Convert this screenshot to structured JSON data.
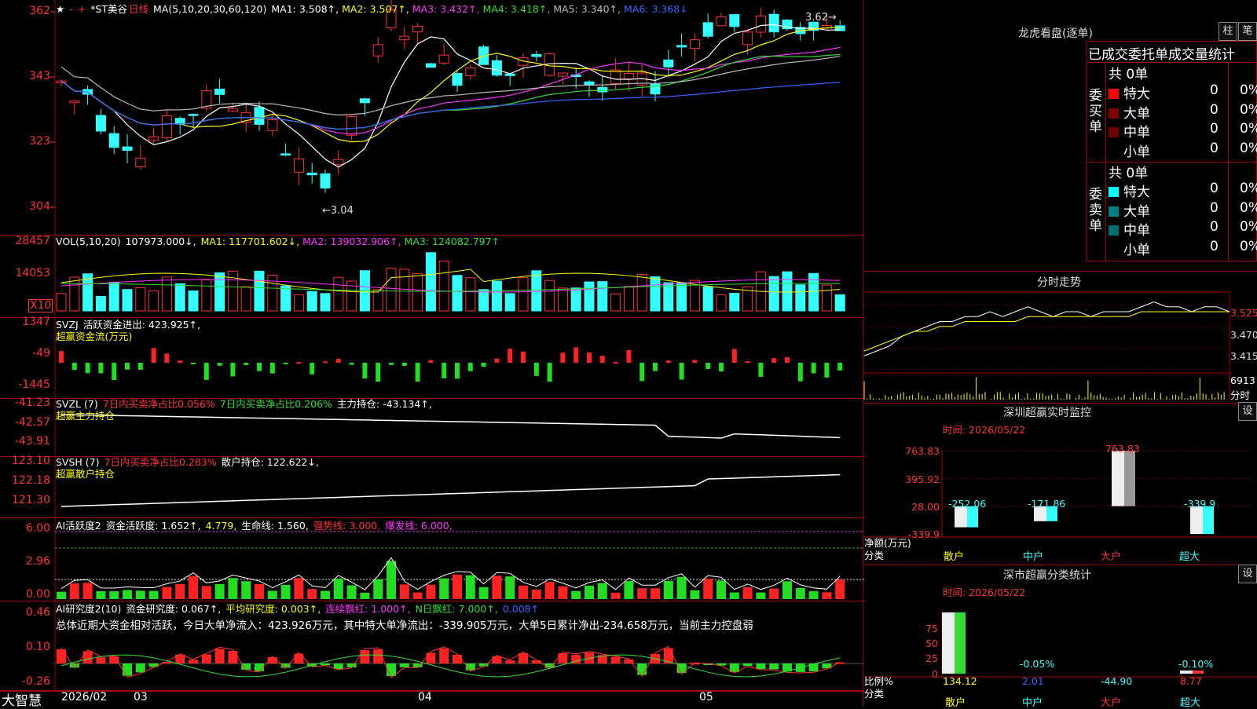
{
  "main": {
    "hdr_star": "★",
    "hdr_minus": "-",
    "hdr_plus": "+",
    "title": "*ST美谷",
    "period": "日线",
    "ma_label": "MA(5,10,20,30,60,120)",
    "ma": [
      {
        "text": "MA1: 3.508↑,",
        "color": "#ffffff"
      },
      {
        "text": "MA2: 3.507↑,",
        "color": "#ffff00"
      },
      {
        "text": "MA3: 3.432↑,",
        "color": "#ff33ff"
      },
      {
        "text": "MA4: 3.418↑,",
        "color": "#33dd33"
      },
      {
        "text": "MA5: 3.340↑,",
        "color": "#bbbbbb"
      },
      {
        "text": "MA6: 3.368↓",
        "color": "#3366ff"
      }
    ],
    "y_ticks": [
      "362",
      "343",
      "323",
      "304"
    ],
    "high_note": "3.62",
    "low_note": "3.04"
  },
  "vol": {
    "label": "VOL(5,10,20)",
    "value": "107973.000↓,",
    "ma": [
      {
        "text": "MA1: 117701.602↓,",
        "color": "#ffff00"
      },
      {
        "text": "MA2: 139032.906↑,",
        "color": "#ff33ff"
      },
      {
        "text": "MA3: 124082.797↑",
        "color": "#33dd33"
      }
    ],
    "y_ticks": [
      "28457",
      "14053"
    ],
    "unit": "X10"
  },
  "svzj": {
    "label": "SVZJ",
    "title": "活跃资金进出: 423.925↑,",
    "sub": "超赢资金流(万元)",
    "y_ticks": [
      "1347",
      "-49",
      "-1445"
    ]
  },
  "svzl": {
    "label": "SVZL (7)",
    "red1": "7日内买卖净占比0.056%",
    "green1": "7日内买卖净占比0.206%",
    "white1": "主力持仓: -43.134↑,",
    "sub": "超赢主力持仓",
    "y_ticks": [
      "-41.23",
      "-42.57",
      "-43.91"
    ]
  },
  "svsh": {
    "label": "SVSH (7)",
    "red1": "7日内买卖净占比0.283%",
    "white1": "散户持仓: 122.622↓,",
    "sub": "超赢散户持仓",
    "y_ticks": [
      "123.10",
      "122.18",
      "121.30"
    ]
  },
  "ai1": {
    "label": "AI活跃度2",
    "a": "资金活跃度: 1.652↑,",
    "b": "4.779,",
    "c": "生命线: 1.560,",
    "d": "强势线: 3.000,",
    "e": "爆发线: 6.000,",
    "y_ticks": [
      "6.00",
      "2.96",
      "0.00"
    ]
  },
  "ai2": {
    "label": "AI研究度2(10)",
    "a": "资金研究度: 0.067↑,",
    "b": "平均研究度: 0.003↑,",
    "c": "连续飘红: 1.000↑,",
    "d": "N日飘红: 7.000↑,",
    "e": "0.008↑",
    "summary": "总体近期大资金相对活跃，今日大单净流入：423.926万元，其中特大单净流出：-339.905万元，大单5日累计净出-234.658万元，当前主力控盘弱",
    "y_ticks": [
      "0.46",
      "0.10",
      "-0.26"
    ]
  },
  "xaxis": {
    "brand": "大智慧",
    "labels": [
      "2026/02",
      "03",
      "04",
      "05"
    ]
  },
  "right": {
    "lhb_title": "龙虎看盘(逐单)",
    "btn_bar": "柱",
    "btn_pen": "笔",
    "tabs": [
      "已成交",
      "委托单",
      "成交量统计"
    ],
    "buy_side": "委买单",
    "sell_side": "委卖单",
    "buy_total": "共 0单",
    "sell_total": "共 0单",
    "buy_rows": [
      {
        "name": "特大",
        "count": "0",
        "pct": "0%",
        "color": "#ff0000"
      },
      {
        "name": "大单",
        "count": "0",
        "pct": "0%",
        "color": "#800000"
      },
      {
        "name": "中单",
        "count": "0",
        "pct": "0%",
        "color": "#700000"
      },
      {
        "name": "小单",
        "count": "0",
        "pct": "0%",
        "color": ""
      }
    ],
    "sell_rows": [
      {
        "name": "特大",
        "count": "0",
        "pct": "0%",
        "color": "#00ffff"
      },
      {
        "name": "大单",
        "count": "0",
        "pct": "0%",
        "color": "#008080"
      },
      {
        "name": "中单",
        "count": "0",
        "pct": "0%",
        "color": "#007070"
      },
      {
        "name": "小单",
        "count": "0",
        "pct": "0%",
        "color": ""
      }
    ],
    "intraday_title": "分时走势",
    "intraday_ticks": [
      "3.525",
      "3.470",
      "3.415"
    ],
    "intraday_vol": "6913",
    "intraday_vol_unit": "分时",
    "sz_title": "深圳超赢实时监控",
    "sz_btn": "设",
    "sz_time": "时间: 2026/05/22",
    "sz_ticks": [
      "763.83",
      "395.92",
      "28.00",
      "-339.9"
    ],
    "sz_ylabel": "净额(万元)",
    "sz_xlabel": "分类",
    "classify_title": "深市超赢分类统计",
    "classify_btn": "设",
    "classify_time": "时间: 2026/05/22",
    "classify_ticks": [
      "75",
      "50",
      "25",
      "0"
    ],
    "classify_ylabel": "比例%",
    "classify_xlabel": "分类"
  },
  "chart_data": [
    {
      "type": "bar",
      "title": "深圳超赢实时监控",
      "categories": [
        "散户",
        "中户",
        "大户",
        "超大"
      ],
      "values": [
        -252.06,
        -171.86,
        763.83,
        -339.9
      ],
      "ylim": [
        -339.9,
        763.83
      ],
      "ylabel": "净额(万元)",
      "xlabel": "分类"
    },
    {
      "type": "bar",
      "title": "深市超赢分类统计",
      "categories": [
        "散户",
        "中户",
        "大户",
        "超大"
      ],
      "values": [
        134.12,
        2.01,
        -44.9,
        8.77
      ],
      "bar_labels": [
        "",
        "-0.05%",
        "",
        "-0.10%"
      ],
      "ylim": [
        0,
        75
      ],
      "ylabel": "比例%",
      "xlabel": "分类"
    },
    {
      "type": "line",
      "title": "分时走势",
      "series": [
        {
          "values": [
            3.42,
            3.43,
            3.44,
            3.46,
            3.47,
            3.48,
            3.49,
            3.49,
            3.5,
            3.5,
            3.51,
            3.5,
            3.51,
            3.52,
            3.51,
            3.5,
            3.51,
            3.51,
            3.5,
            3.51,
            3.51,
            3.51,
            3.52,
            3.53,
            3.52,
            3.52,
            3.51,
            3.52,
            3.52,
            3.51
          ]
        },
        {
          "values": [
            3.43,
            3.44,
            3.45,
            3.46,
            3.47,
            3.47,
            3.48,
            3.48,
            3.49,
            3.49,
            3.49,
            3.49,
            3.49,
            3.5,
            3.5,
            3.5,
            3.5,
            3.5,
            3.5,
            3.5,
            3.5,
            3.5,
            3.51,
            3.51,
            3.51,
            3.51,
            3.51,
            3.51,
            3.51,
            3.51
          ]
        }
      ],
      "ylim": [
        3.39,
        3.55
      ]
    }
  ]
}
